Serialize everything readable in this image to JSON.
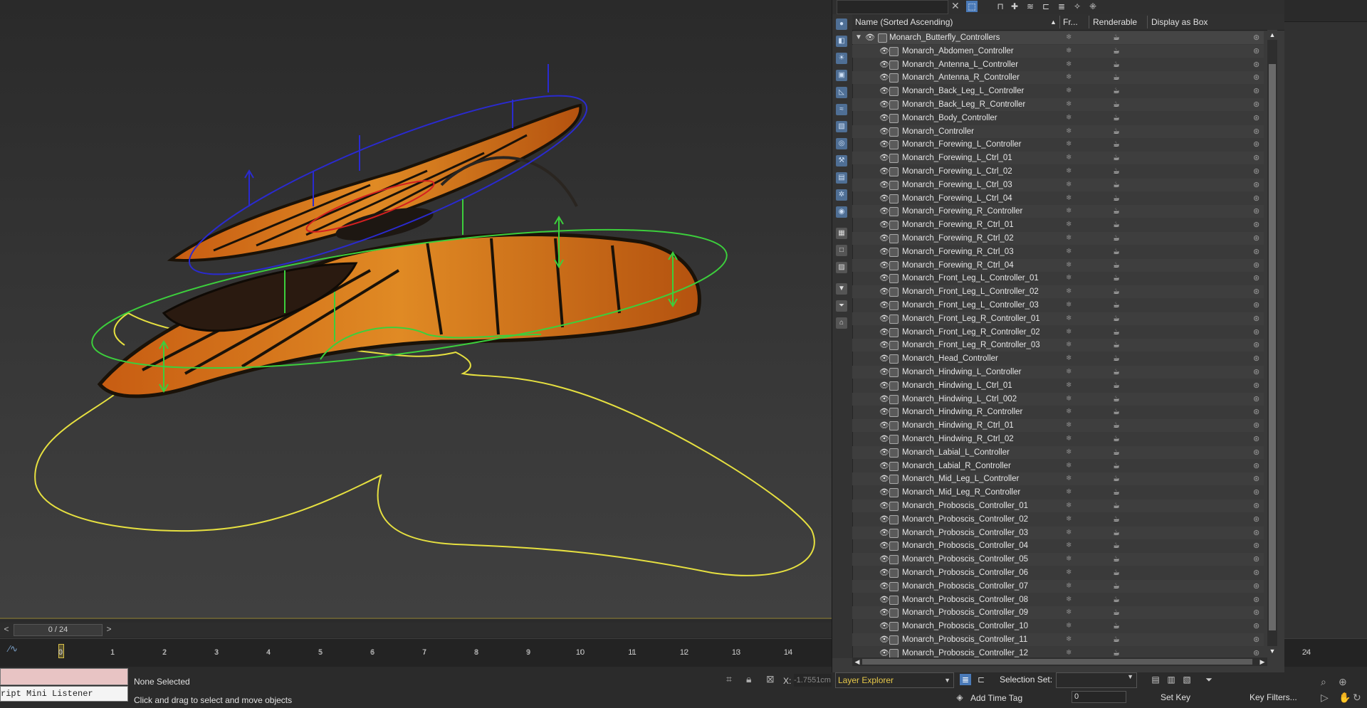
{
  "viewport": {
    "time_field": "0 / 24",
    "prev_label": "<",
    "next_label": ">"
  },
  "timeline": {
    "ticks": [
      "0",
      "1",
      "2",
      "3",
      "4",
      "5",
      "6",
      "7",
      "8",
      "9",
      "10",
      "11",
      "12",
      "13",
      "14",
      "24"
    ]
  },
  "status": {
    "listener_text": "ript Mini Listener",
    "selection_text": "None Selected",
    "prompt_text": "Click and drag to select and move objects",
    "coord_label": "X:",
    "coord_value": "-1.7551cm"
  },
  "explorer": {
    "columns": {
      "name": "Name (Sorted Ascending)",
      "sort_indicator": "▲",
      "frozen": "Fr...",
      "renderable": "Renderable",
      "display_as_box": "Display as Box"
    },
    "parent": "Monarch_Butterfly_Controllers",
    "items": [
      "Monarch_Abdomen_Controller",
      "Monarch_Antenna_L_Controller",
      "Monarch_Antenna_R_Controller",
      "Monarch_Back_Leg_L_Controller",
      "Monarch_Back_Leg_R_Controller",
      "Monarch_Body_Controller",
      "Monarch_Controller",
      "Monarch_Forewing_L_Controller",
      "Monarch_Forewing_L_Ctrl_01",
      "Monarch_Forewing_L_Ctrl_02",
      "Monarch_Forewing_L_Ctrl_03",
      "Monarch_Forewing_L_Ctrl_04",
      "Monarch_Forewing_R_Controller",
      "Monarch_Forewing_R_Ctrl_01",
      "Monarch_Forewing_R_Ctrl_02",
      "Monarch_Forewing_R_Ctrl_03",
      "Monarch_Forewing_R_Ctrl_04",
      "Monarch_Front_Leg_L_Controller_01",
      "Monarch_Front_Leg_L_Controller_02",
      "Monarch_Front_Leg_L_Controller_03",
      "Monarch_Front_Leg_R_Controller_01",
      "Monarch_Front_Leg_R_Controller_02",
      "Monarch_Front_Leg_R_Controller_03",
      "Monarch_Head_Controller",
      "Monarch_Hindwing_L_Controller",
      "Monarch_Hindwing_L_Ctrl_01",
      "Monarch_Hindwing_L_Ctrl_002",
      "Monarch_Hindwing_R_Controller",
      "Monarch_Hindwing_R_Ctrl_01",
      "Monarch_Hindwing_R_Ctrl_02",
      "Monarch_Labial_L_Controller",
      "Monarch_Labial_R_Controller",
      "Monarch_Mid_Leg_L_Controller",
      "Monarch_Mid_Leg_R_Controller",
      "Monarch_Proboscis_Controller_01",
      "Monarch_Proboscis_Controller_02",
      "Monarch_Proboscis_Controller_03",
      "Monarch_Proboscis_Controller_04",
      "Monarch_Proboscis_Controller_05",
      "Monarch_Proboscis_Controller_06",
      "Monarch_Proboscis_Controller_07",
      "Monarch_Proboscis_Controller_08",
      "Monarch_Proboscis_Controller_09",
      "Monarch_Proboscis_Controller_10",
      "Monarch_Proboscis_Controller_11",
      "Monarch_Proboscis_Controller_12"
    ]
  },
  "bottom_bar": {
    "explorer_select": "Layer Explorer",
    "selection_set_label": "Selection Set:",
    "add_time_tag": "Add Time Tag",
    "frame_spinner": "0",
    "set_key": "Set Key",
    "key_filters": "Key Filters..."
  },
  "colors": {
    "accent": "#4a7ab8",
    "highlight": "#e6c84a",
    "wing_orange": "#d9761a",
    "control_yellow": "#e6e040",
    "control_green": "#3ccf3c",
    "control_blue": "#2a2ad0"
  }
}
